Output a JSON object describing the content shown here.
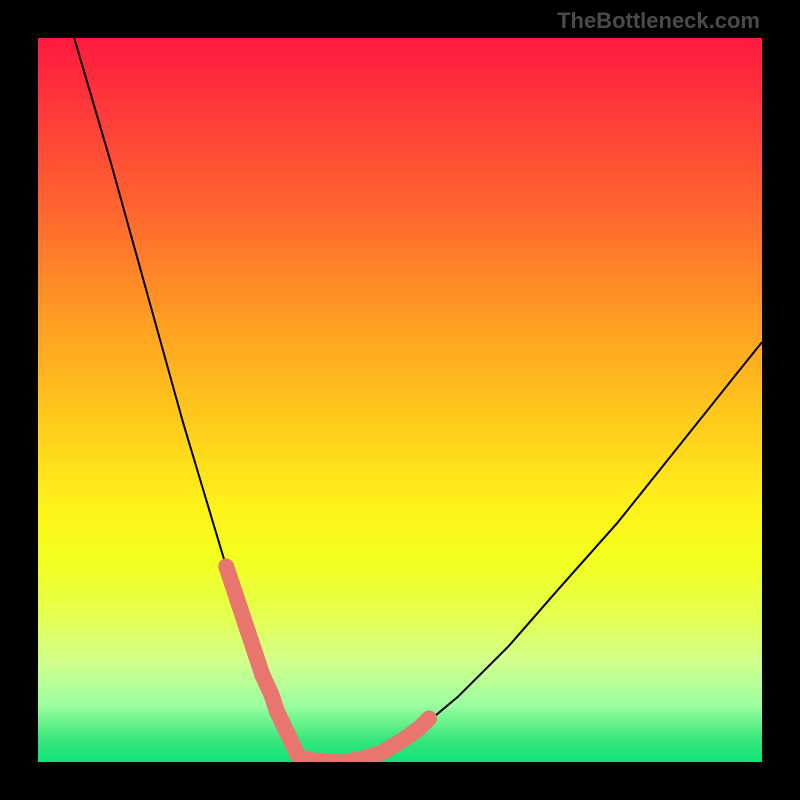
{
  "attribution": "TheBottleneck.com",
  "colors": {
    "frame": "#000000",
    "attrib": "#4a4a4a",
    "curve": "#000000",
    "marker": "#e8766f"
  },
  "chart_data": {
    "type": "line",
    "title": "",
    "xlabel": "",
    "ylabel": "",
    "xlim": [
      0,
      100
    ],
    "ylim": [
      0,
      100
    ],
    "grid": false,
    "legend": false,
    "series": [
      {
        "name": "bottleneck-curve",
        "x": [
          5,
          10,
          15,
          20,
          23,
          26,
          29,
          31,
          33,
          35,
          37,
          40,
          43,
          47,
          52,
          58,
          65,
          72,
          80,
          88,
          96,
          100
        ],
        "values": [
          100,
          83,
          65,
          47,
          37,
          27,
          18,
          12,
          7,
          3,
          1,
          0,
          0,
          1,
          4,
          9,
          16,
          24,
          33,
          43,
          53,
          58
        ]
      }
    ],
    "markers": {
      "name": "highlight-band",
      "x": [
        26,
        27.5,
        29,
        30,
        31,
        32.2,
        33,
        36,
        38,
        40,
        42,
        44,
        46,
        47.3,
        48.5,
        50,
        51.5,
        52.8,
        54
      ],
      "values": [
        27,
        22.5,
        18,
        15,
        12,
        9.4,
        7,
        0.7,
        0.2,
        0,
        0,
        0.3,
        0.8,
        1.2,
        1.9,
        2.8,
        3.8,
        4.8,
        6.0
      ]
    }
  }
}
